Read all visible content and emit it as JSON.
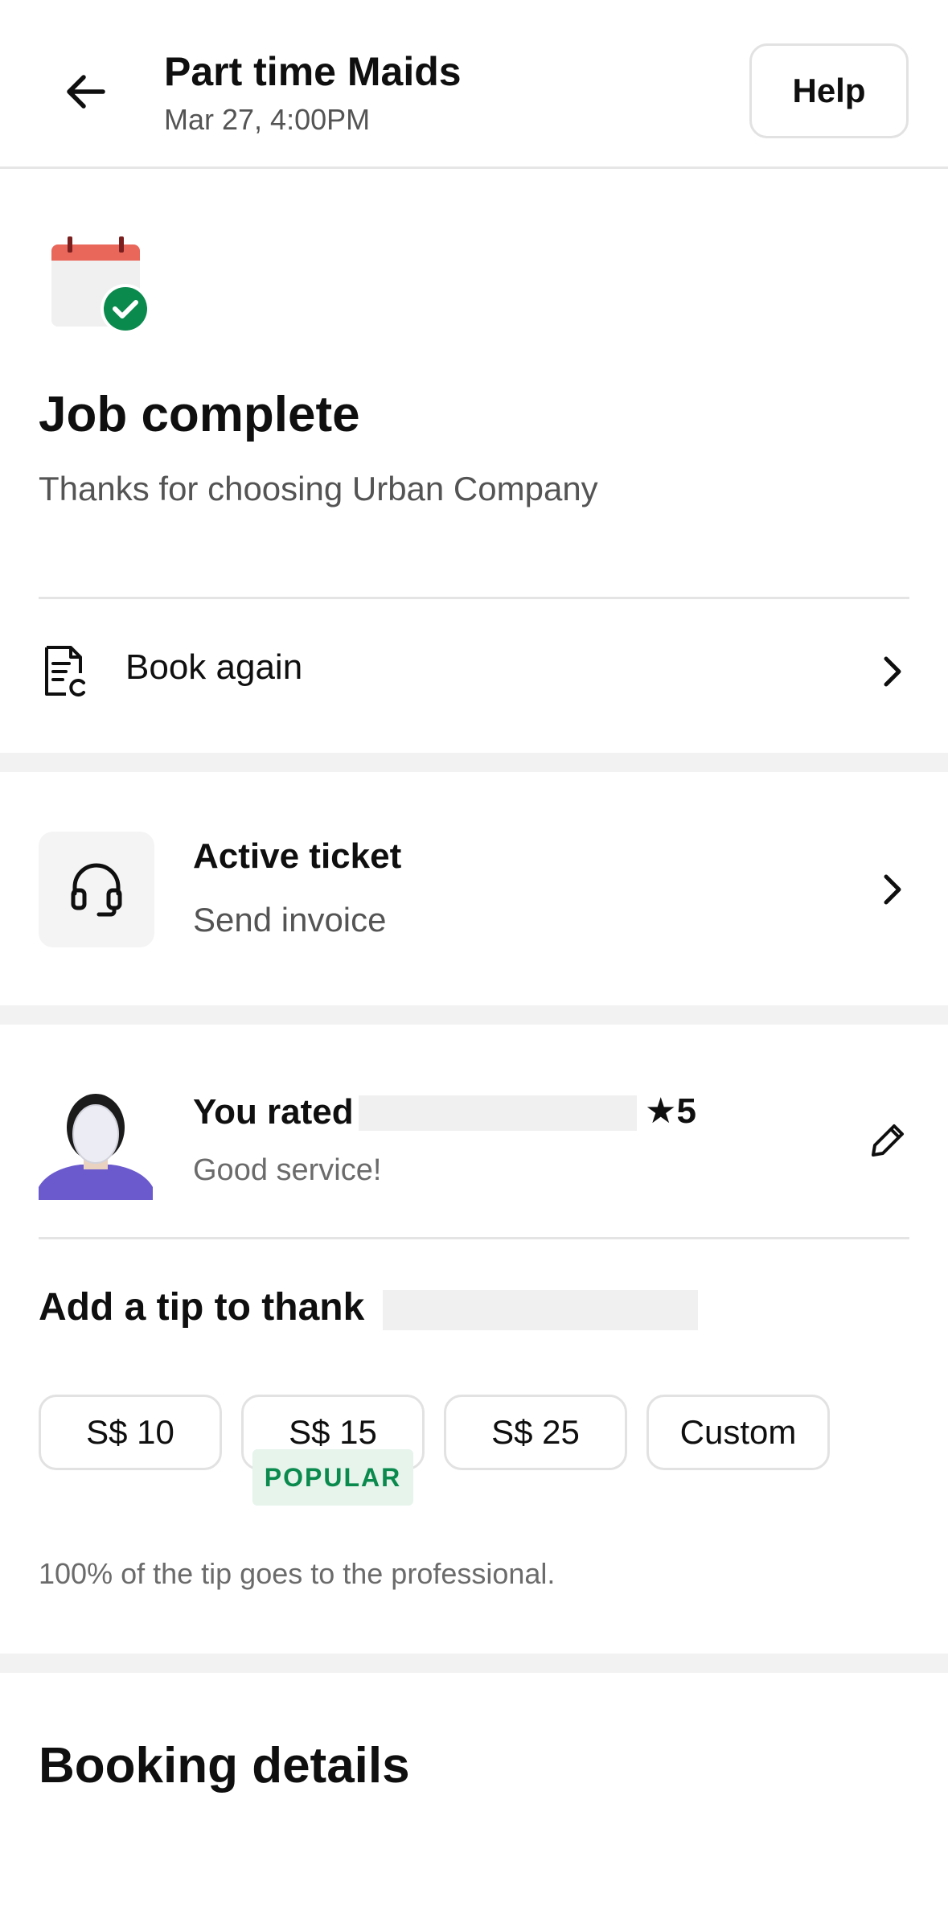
{
  "header": {
    "title": "Part time Maids",
    "subtitle": "Mar 27, 4:00PM",
    "help_label": "Help"
  },
  "status": {
    "title": "Job complete",
    "subtitle": "Thanks for choosing Urban Company"
  },
  "book_again": {
    "label": "Book again"
  },
  "ticket": {
    "title": "Active ticket",
    "subtitle": "Send invoice"
  },
  "rating": {
    "label": "You rated",
    "stars": "★5",
    "comment": "Good service!"
  },
  "tip": {
    "title": "Add a tip to thank",
    "options": [
      "S$ 10",
      "S$ 15",
      "S$ 25",
      "Custom"
    ],
    "popular_label": "POPULAR",
    "note": "100% of the tip goes to the professional."
  },
  "booking": {
    "title": "Booking details"
  },
  "colors": {
    "success_green": "#0b8a4e",
    "calendar_red": "#e9665a",
    "avatar_shirt": "#6a5acd"
  },
  "icons": {
    "back": "arrow-left-icon",
    "calendar": "calendar-check-icon",
    "receipt": "receipt-icon",
    "headset": "headset-icon",
    "chevron": "chevron-right-icon",
    "edit": "pencil-icon"
  }
}
